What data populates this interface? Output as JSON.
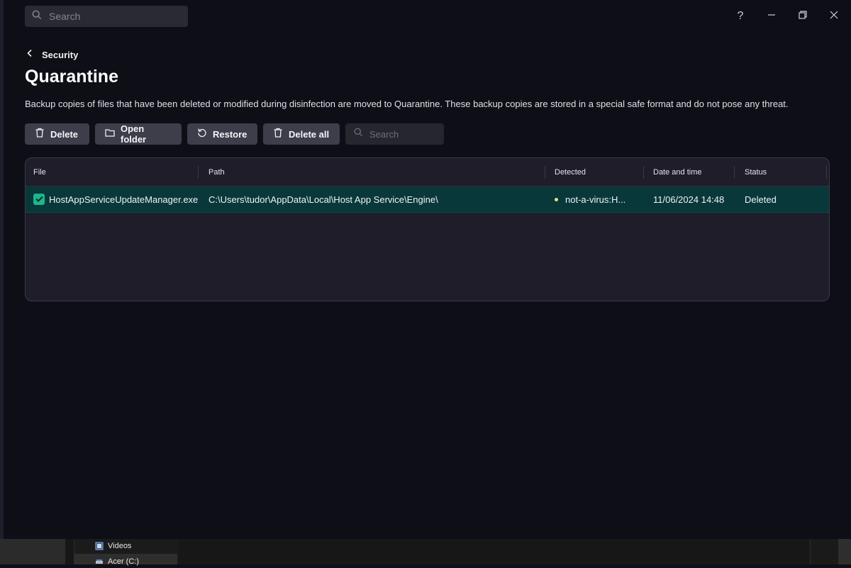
{
  "topbar": {
    "search_placeholder": "Search",
    "help_label": "?"
  },
  "breadcrumb": {
    "label": "Security"
  },
  "page": {
    "title": "Quarantine",
    "description": "Backup copies of files that have been deleted or modified during disinfection are moved to Quarantine. These backup copies are stored in a special safe format and do not pose any threat."
  },
  "toolbar": {
    "delete_label": "Delete",
    "open_folder_label": "Open folder",
    "restore_label": "Restore",
    "delete_all_label": "Delete all",
    "search_placeholder": "Search"
  },
  "table": {
    "columns": [
      "File",
      "Path",
      "Detected",
      "Date and time",
      "Status"
    ],
    "rows": [
      {
        "checked": true,
        "file": "HostAppServiceUpdateManager.exe",
        "path": "C:\\Users\\tudor\\AppData\\Local\\Host App Service\\Engine\\",
        "detected": "not-a-virus:H...",
        "datetime": "11/06/2024 14:48",
        "status": "Deleted"
      }
    ]
  },
  "explorer": {
    "items": [
      "Videos",
      "Acer (C:)"
    ]
  },
  "colors": {
    "accent": "#1fb58c",
    "selected_row": "#08383a",
    "detected_dot": "#f2d891",
    "background": "#0d0e16"
  }
}
